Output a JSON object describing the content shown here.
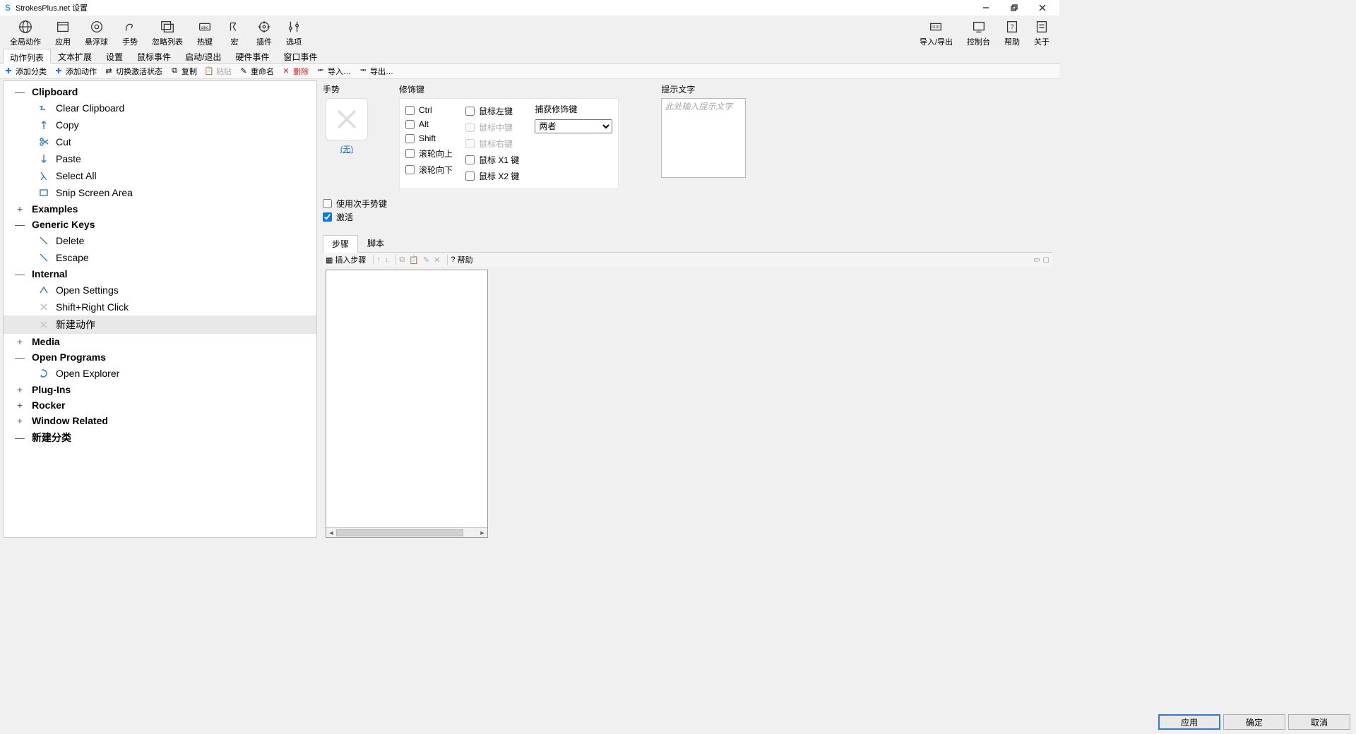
{
  "window": {
    "title": "StrokesPlus.net 设置"
  },
  "toolbar": [
    {
      "label": "全局动作",
      "icon": "globe"
    },
    {
      "label": "应用",
      "icon": "window"
    },
    {
      "label": "悬浮球",
      "icon": "float"
    },
    {
      "label": "手势",
      "icon": "gesture"
    },
    {
      "label": "忽略列表",
      "icon": "ignore"
    },
    {
      "label": "热键",
      "icon": "hotkey"
    },
    {
      "label": "宏",
      "icon": "macro"
    },
    {
      "label": "插件",
      "icon": "plugin"
    },
    {
      "label": "选项",
      "icon": "options"
    }
  ],
  "toolbar_right": [
    {
      "label": "导入/导出",
      "icon": "io"
    },
    {
      "label": "控制台",
      "icon": "console"
    },
    {
      "label": "帮助",
      "icon": "help"
    },
    {
      "label": "关于",
      "icon": "about"
    }
  ],
  "tabs": [
    "动作列表",
    "文本扩展",
    "设置",
    "鼠标事件",
    "启动/退出",
    "硬件事件",
    "窗口事件"
  ],
  "active_tab": 0,
  "subtoolbar": {
    "add_category": "添加分类",
    "add_action": "添加动作",
    "toggle_active": "切换激活状态",
    "copy": "复制",
    "paste": "粘贴",
    "rename": "重命名",
    "delete": "删除",
    "import": "导入…",
    "export": "导出…"
  },
  "tree": [
    {
      "type": "cat",
      "label": "Clipboard",
      "expanded": true,
      "children": [
        {
          "label": "Clear Clipboard",
          "icon": "zigzag"
        },
        {
          "label": "Copy",
          "icon": "arrow-up"
        },
        {
          "label": "Cut",
          "icon": "scissors"
        },
        {
          "label": "Paste",
          "icon": "arrow-down"
        },
        {
          "label": "Select All",
          "icon": "lambda"
        },
        {
          "label": "Snip Screen Area",
          "icon": "rect"
        }
      ]
    },
    {
      "type": "cat",
      "label": "Examples",
      "expanded": false
    },
    {
      "type": "cat",
      "label": "Generic Keys",
      "expanded": true,
      "children": [
        {
          "label": "Delete",
          "icon": "diag"
        },
        {
          "label": "Escape",
          "icon": "diag"
        }
      ]
    },
    {
      "type": "cat",
      "label": "Internal",
      "expanded": true,
      "children": [
        {
          "label": "Open Settings",
          "icon": "triangle"
        },
        {
          "label": "Shift+Right Click",
          "icon": "x-grey"
        },
        {
          "label": "新建动作",
          "icon": "x-grey",
          "selected": true
        }
      ]
    },
    {
      "type": "cat",
      "label": "Media",
      "expanded": false
    },
    {
      "type": "cat",
      "label": "Open Programs",
      "expanded": true,
      "children": [
        {
          "label": "Open Explorer",
          "icon": "curl"
        }
      ]
    },
    {
      "type": "cat",
      "label": "Plug-Ins",
      "expanded": false
    },
    {
      "type": "cat",
      "label": "Rocker",
      "expanded": false
    },
    {
      "type": "cat",
      "label": "Window Related",
      "expanded": false
    },
    {
      "type": "cat",
      "label": "新建分类",
      "expanded": true
    }
  ],
  "config": {
    "gesture_label": "手势",
    "gesture_none": "(无)",
    "modifiers_label": "修饰键",
    "mods_left": [
      "Ctrl",
      "Alt",
      "Shift",
      "滚轮向上",
      "滚轮向下"
    ],
    "mods_right": [
      "鼠标左键",
      "鼠标中键",
      "鼠标右键",
      "鼠标 X1 键",
      "鼠标 X2 键"
    ],
    "mods_right_disabled": [
      1,
      2
    ],
    "capture_label": "捕获修饰键",
    "capture_value": "两者",
    "hint_label": "提示文字",
    "hint_placeholder": "此处输入提示文字",
    "use_secondary": "使用次手势键",
    "activate": "激活"
  },
  "lower_tabs": [
    "步骤",
    "脚本"
  ],
  "lower_active": 0,
  "step_toolbar": {
    "insert": "插入步骤",
    "help": "帮助"
  },
  "buttons": {
    "apply": "应用",
    "ok": "确定",
    "cancel": "取消"
  }
}
